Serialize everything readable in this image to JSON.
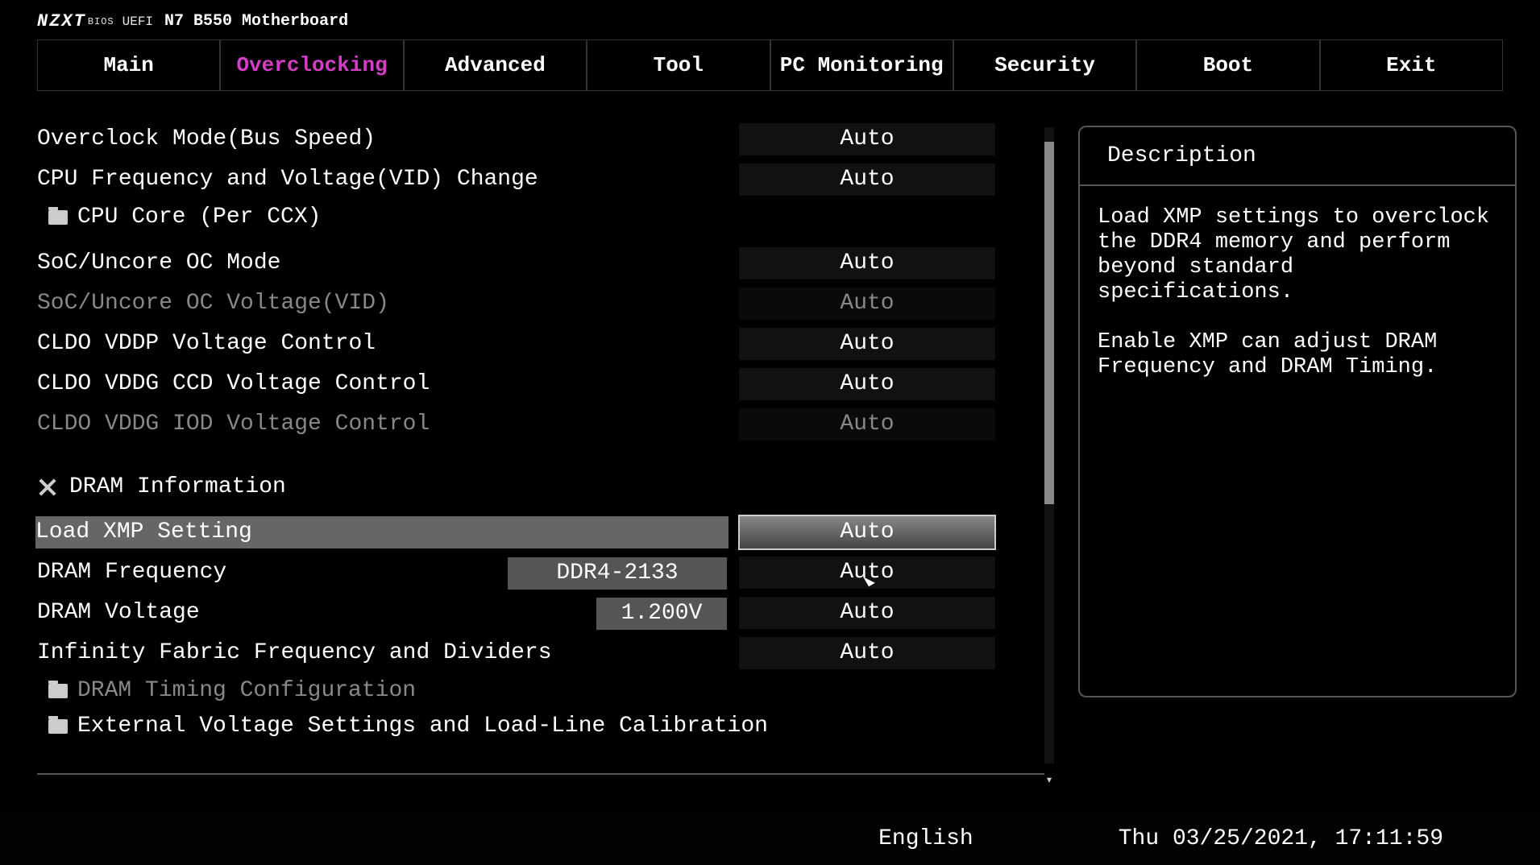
{
  "header": {
    "brand_bold": "NZXT",
    "brand_sub": "BIOS",
    "brand_uefi": "UEFI",
    "board": "N7 B550 Motherboard"
  },
  "tabs": [
    "Main",
    "Overclocking",
    "Advanced",
    "Tool",
    "PC Monitoring",
    "Security",
    "Boot",
    "Exit"
  ],
  "active_tab_index": 1,
  "settings": {
    "overclock_mode": {
      "label": "Overclock Mode(Bus Speed)",
      "value": "Auto"
    },
    "cpu_freq_vid": {
      "label": "CPU Frequency and Voltage(VID) Change",
      "value": "Auto"
    },
    "cpu_core_ccx": {
      "label": "CPU Core (Per CCX)"
    },
    "soc_oc_mode": {
      "label": "SoC/Uncore OC Mode",
      "value": "Auto"
    },
    "soc_oc_voltage": {
      "label": "SoC/Uncore OC Voltage(VID)",
      "value": "Auto",
      "disabled": true
    },
    "cldo_vddp": {
      "label": "CLDO VDDP Voltage Control",
      "value": "Auto"
    },
    "cldo_vddg_ccd": {
      "label": "CLDO VDDG CCD Voltage Control",
      "value": "Auto"
    },
    "cldo_vddg_iod": {
      "label": "CLDO VDDG IOD Voltage Control",
      "value": "Auto",
      "disabled": true
    },
    "dram_info_header": "DRAM Information",
    "xmp": {
      "label": "Load XMP Setting",
      "value": "Auto",
      "selected": true
    },
    "dram_freq": {
      "label": "DRAM Frequency",
      "mid": "DDR4-2133",
      "value": "Auto"
    },
    "dram_voltage": {
      "label": "DRAM Voltage",
      "mid": "1.200V",
      "value": "Auto"
    },
    "if_freq": {
      "label": "Infinity Fabric Frequency and Dividers",
      "value": "Auto"
    },
    "dram_timing": {
      "label": "DRAM Timing Configuration",
      "disabled": true
    },
    "ext_voltage": {
      "label": "External Voltage Settings and Load-Line Calibration"
    }
  },
  "description": {
    "title": "Description",
    "body": "Load XMP settings to overclock the DDR4 memory and perform beyond standard specifications.\n\nEnable XMP can adjust DRAM Frequency and DRAM Timing."
  },
  "footer": {
    "language": "English",
    "datetime": "Thu 03/25/2021, 17:11:59"
  }
}
